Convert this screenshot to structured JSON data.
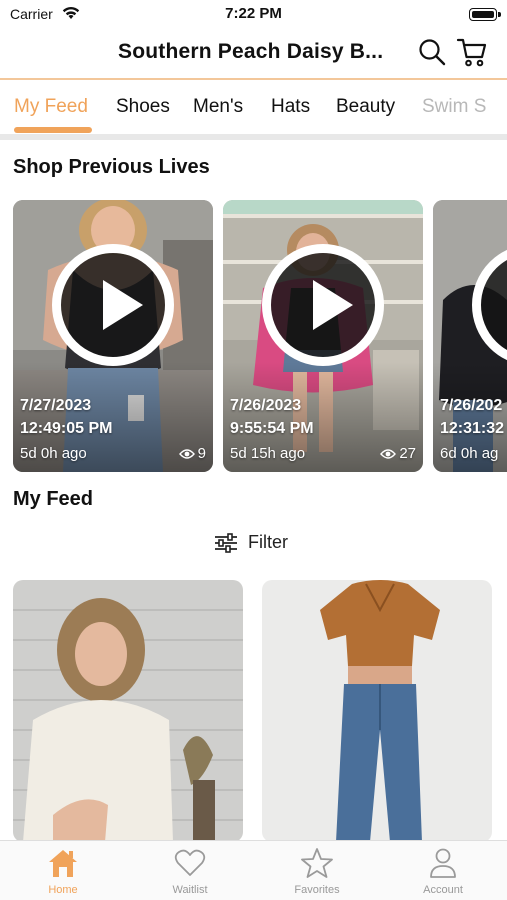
{
  "status_bar": {
    "carrier": "Carrier",
    "time": "7:22 PM"
  },
  "header": {
    "title": "Southern Peach Daisy B..."
  },
  "tabs": [
    {
      "label": "My Feed",
      "active": true
    },
    {
      "label": "Shoes",
      "active": false
    },
    {
      "label": "Men's",
      "active": false
    },
    {
      "label": "Hats",
      "active": false
    },
    {
      "label": "Beauty",
      "active": false
    },
    {
      "label": "Swim S",
      "active": false
    }
  ],
  "lives_section": {
    "title": "Shop Previous Lives",
    "items": [
      {
        "date": "7/27/2023",
        "time": "12:49:05 PM",
        "ago": "5d 0h ago",
        "views": "9"
      },
      {
        "date": "7/26/2023",
        "time": "9:55:54 PM",
        "ago": "5d 15h ago",
        "views": "27"
      },
      {
        "date": "7/26/202",
        "time": "12:31:32",
        "ago": "6d 0h ag",
        "views": ""
      }
    ]
  },
  "feed_section": {
    "title": "My Feed",
    "filter_label": "Filter"
  },
  "bottom_nav": [
    {
      "label": "Home",
      "icon": "home-icon",
      "active": true
    },
    {
      "label": "Waitlist",
      "icon": "heart-icon",
      "active": false
    },
    {
      "label": "Favorites",
      "icon": "star-icon",
      "active": false
    },
    {
      "label": "Account",
      "icon": "person-icon",
      "active": false
    }
  ],
  "colors": {
    "accent": "#f0a35a",
    "header_line": "#f3c79a",
    "inactive": "#999999"
  }
}
